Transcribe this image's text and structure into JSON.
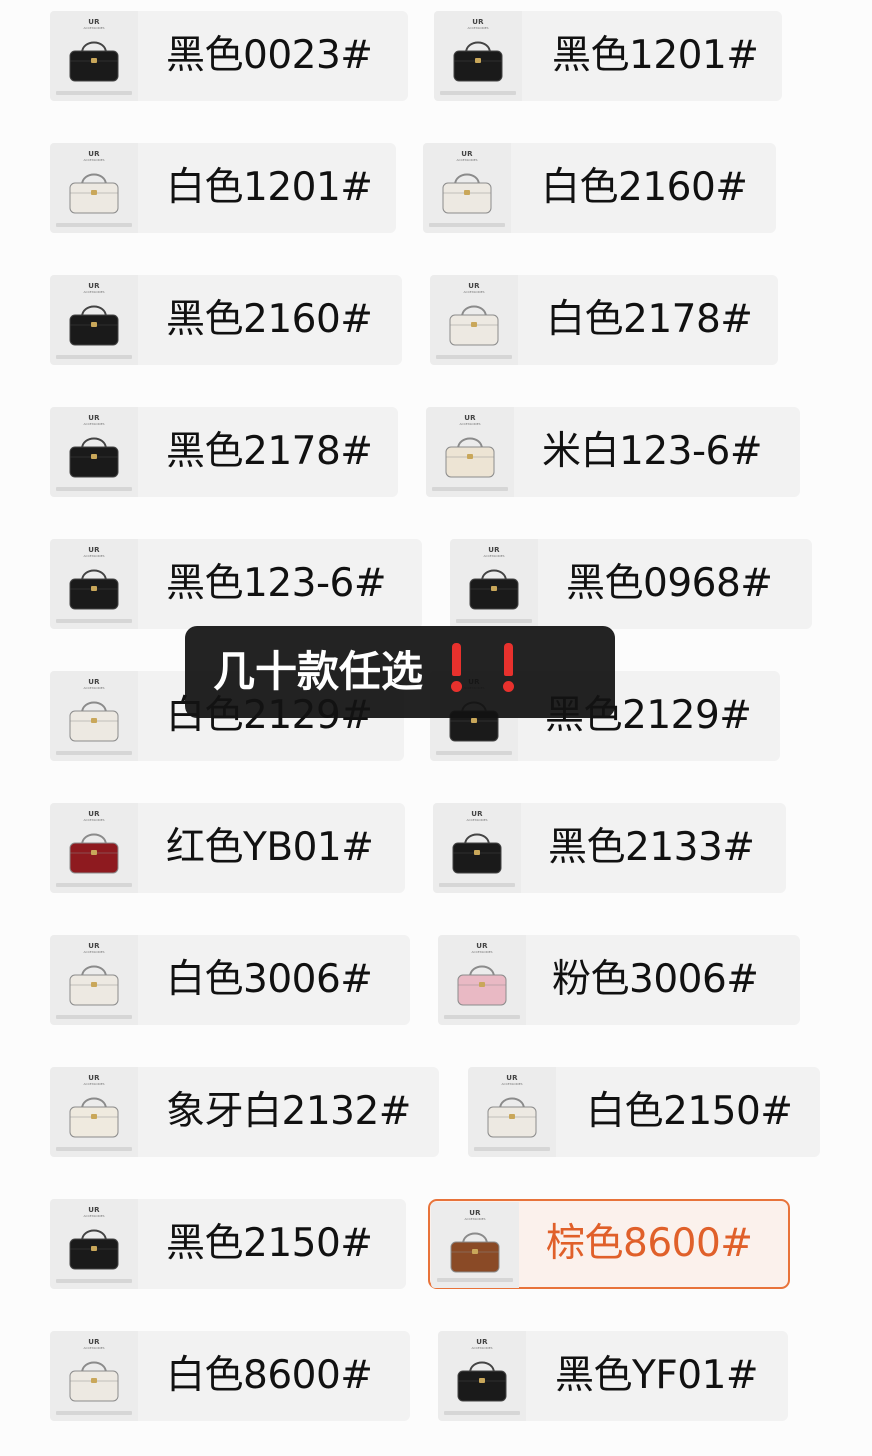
{
  "brand": {
    "name": "UR",
    "sub": "ACCESSORIES"
  },
  "toast": {
    "text": "几十款任选"
  },
  "items": [
    {
      "label": "黑色0023#",
      "bag_icon": "handbag-icon",
      "color": "#1a1a1a"
    },
    {
      "label": "黑色1201#",
      "bag_icon": "handbag-icon",
      "color": "#1a1a1a"
    },
    {
      "label": "白色1201#",
      "bag_icon": "handbag-icon",
      "color": "#ede9e2"
    },
    {
      "label": "白色2160#",
      "bag_icon": "handbag-icon",
      "color": "#ede9e2"
    },
    {
      "label": "黑色2160#",
      "bag_icon": "handbag-icon",
      "color": "#1a1a1a"
    },
    {
      "label": "白色2178#",
      "bag_icon": "handbag-icon",
      "color": "#ede9e2"
    },
    {
      "label": "黑色2178#",
      "bag_icon": "handbag-icon",
      "color": "#1a1a1a"
    },
    {
      "label": "米白123-6#",
      "bag_icon": "handbag-icon",
      "color": "#ede4d4"
    },
    {
      "label": "黑色123-6#",
      "bag_icon": "handbag-icon",
      "color": "#1a1a1a"
    },
    {
      "label": "黑色0968#",
      "bag_icon": "handbag-icon",
      "color": "#1a1a1a"
    },
    {
      "label": "白色2129#",
      "bag_icon": "handbag-icon",
      "color": "#ede9e2"
    },
    {
      "label": "黑色2129#",
      "bag_icon": "handbag-icon",
      "color": "#1a1a1a"
    },
    {
      "label": "红色YB01#",
      "bag_icon": "handbag-icon",
      "color": "#8e1a1f"
    },
    {
      "label": "黑色2133#",
      "bag_icon": "handbag-icon",
      "color": "#1a1a1a"
    },
    {
      "label": "白色3006#",
      "bag_icon": "handbag-icon",
      "color": "#ede9e2"
    },
    {
      "label": "粉色3006#",
      "bag_icon": "handbag-icon",
      "color": "#e9b9c4"
    },
    {
      "label": "象牙白2132#",
      "bag_icon": "handbag-icon",
      "color": "#efeadf"
    },
    {
      "label": "白色2150#",
      "bag_icon": "handbag-icon",
      "color": "#ede9e2"
    },
    {
      "label": "黑色2150#",
      "bag_icon": "handbag-icon",
      "color": "#1a1a1a"
    },
    {
      "label": "棕色8600#",
      "bag_icon": "handbag-icon",
      "color": "#8a4a26",
      "selected": true,
      "accent": "#e8733a"
    },
    {
      "label": "白色8600#",
      "bag_icon": "handbag-icon",
      "color": "#ede9e2"
    },
    {
      "label": "黑色YF01#",
      "bag_icon": "handbag-icon",
      "color": "#1a1a1a"
    }
  ]
}
